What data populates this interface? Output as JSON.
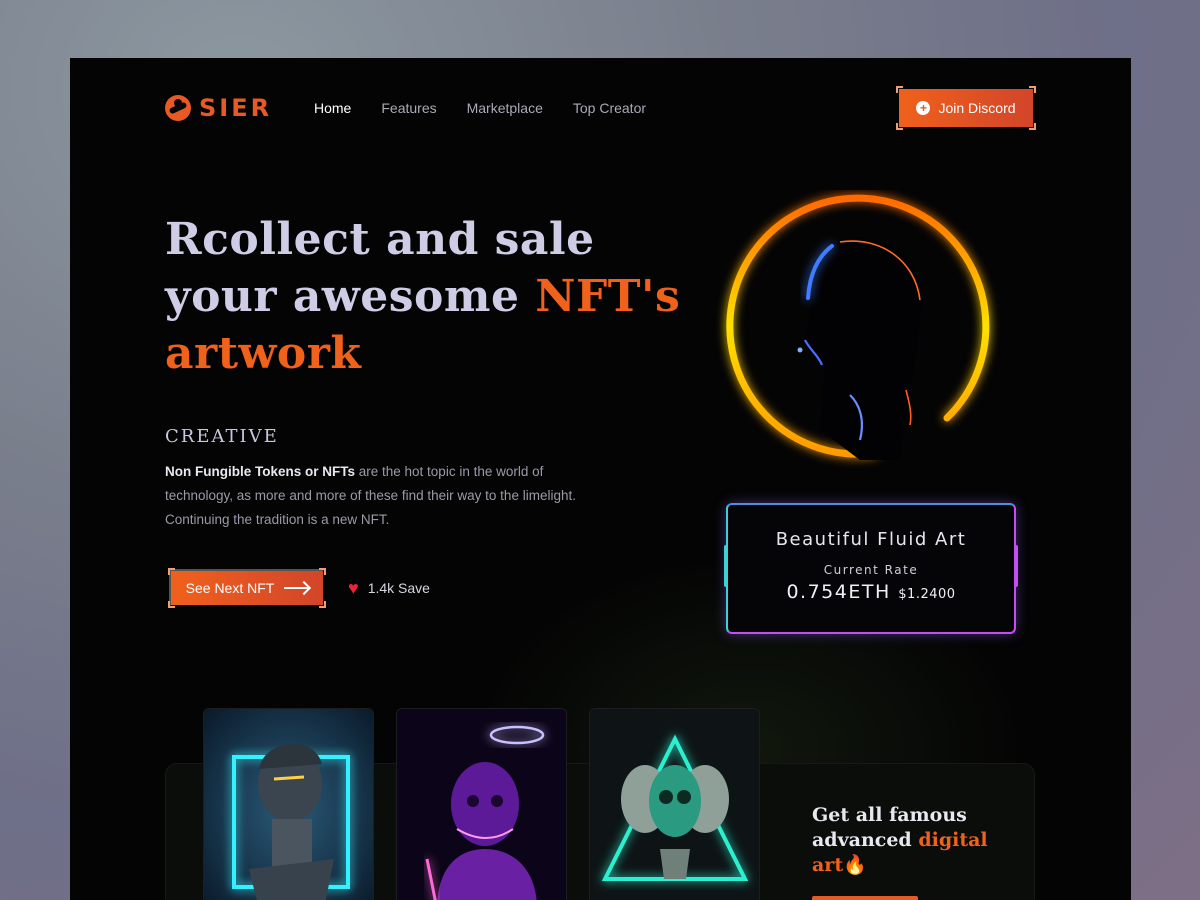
{
  "brand": {
    "name": "SIER"
  },
  "nav": {
    "items": [
      {
        "label": "Home",
        "active": true
      },
      {
        "label": "Features",
        "active": false
      },
      {
        "label": "Marketplace",
        "active": false
      },
      {
        "label": "Top Creator",
        "active": false
      }
    ],
    "cta_label": "Join Discord"
  },
  "hero": {
    "title_line1": "Rcollect and sale",
    "title_line2_plain": "your awesome ",
    "title_line2_accent": "NFT's",
    "title_line3": "artwork",
    "eyebrow": "CREATIVE",
    "desc_bold": "Non Fungible Tokens or NFTs",
    "desc_rest": " are the hot topic in the world of technology, as more and more of these find their way to the limelight. Continuing the tradition is a new NFT.",
    "next_button": "See Next NFT",
    "save_count": "1.4k Save"
  },
  "featured": {
    "title": "Beautiful Fluid Art",
    "rate_label": "Current Rate",
    "price_eth": "0.754ETH",
    "price_usd": "$1.2400"
  },
  "promo": {
    "line1": "Get all famous",
    "line2_plain": "advanced ",
    "line2_accent": "digital",
    "line3": "art"
  },
  "colors": {
    "accent": "#f0611c",
    "background": "#040404",
    "ring": "#ffd400",
    "card_border_left": "#3ad2d6",
    "card_border_right": "#c44ef0"
  },
  "icons": {
    "logo": "sier-logo-icon",
    "join": "plus-circle-icon",
    "next": "arrow-right-icon",
    "save": "heart-icon",
    "fire": "fire-icon"
  }
}
